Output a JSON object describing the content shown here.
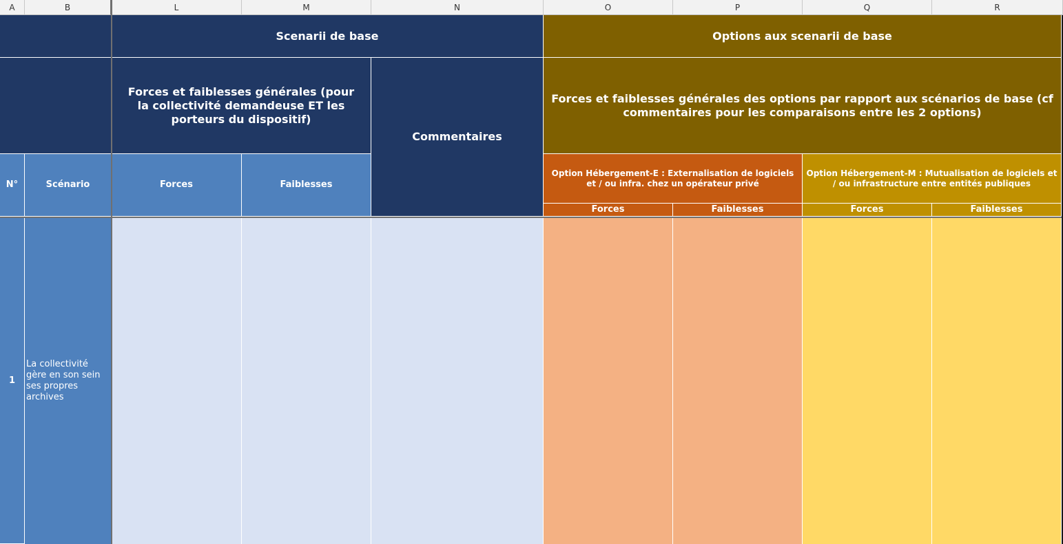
{
  "columns": [
    "A",
    "B",
    "L",
    "M",
    "N",
    "O",
    "P",
    "Q",
    "R"
  ],
  "headers": {
    "scenarii_base": "Scenarii de base",
    "options_base": "Options aux scenarii de base",
    "forces_faiblesses_generales": "Forces et faiblesses générales (pour la collectivité demandeuse ET les porteurs du dispositif)",
    "forces_faiblesses_options": "Forces et faiblesses générales des options par rapport aux scénarios de base (cf commentaires pour les comparaisons entre les 2 options)",
    "commentaires": "Commentaires",
    "num": "N°",
    "scenario": "Scénario",
    "forces": "Forces",
    "faiblesses": "Faiblesses",
    "option_e": "Option Hébergement-E : Externalisation de logiciels et / ou infra. chez un opérateur privé",
    "option_m": "Option Hébergement-M : Mutualisation de logiciels et / ou infrastructure entre entités publiques",
    "option_e_forces": "Forces",
    "option_e_faiblesses": "Faiblesses",
    "option_m_forces": "Forces",
    "option_m_faiblesses": "Faiblesses"
  },
  "rows": [
    {
      "num": "1",
      "scenario": "La collectivité gère en son sein ses propres archives"
    }
  ],
  "colors": {
    "navy": "#203864",
    "olive": "#7f6000",
    "blue": "#4f81bd",
    "rust": "#c55a11",
    "gold": "#bf9000",
    "light_blue": "#d9e2f3",
    "peach": "#f4b183",
    "yellow": "#ffd966"
  }
}
